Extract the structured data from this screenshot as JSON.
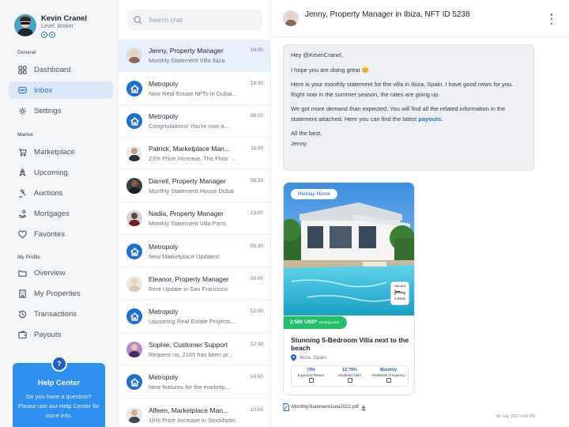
{
  "profile": {
    "name": "Kevin Cranel",
    "level": "Level: Broker"
  },
  "sidebar": {
    "sections": {
      "general": "General",
      "market": "Market",
      "my_profile": "My Profile"
    },
    "items": [
      {
        "label": "Dashboard",
        "icon": "grid-icon"
      },
      {
        "label": "Inbox",
        "icon": "chat-bubble-icon",
        "active": true
      },
      {
        "label": "Settings",
        "icon": "gear-icon"
      },
      {
        "label": "Marketplace",
        "icon": "cart-icon"
      },
      {
        "label": "Upcoming",
        "icon": "rocket-icon"
      },
      {
        "label": "Auctions",
        "icon": "gavel-icon"
      },
      {
        "label": "Mortgages",
        "icon": "hand-coins-icon"
      },
      {
        "label": "Favorites",
        "icon": "heart-icon"
      },
      {
        "label": "Overview",
        "icon": "folder-icon"
      },
      {
        "label": "My Properties",
        "icon": "building-icon"
      },
      {
        "label": "Transactions",
        "icon": "history-icon"
      },
      {
        "label": "Payouts",
        "icon": "wallet-icon"
      }
    ]
  },
  "help": {
    "badge": "?",
    "title": "Help Center",
    "text": "Do you have a question? Please use our Help Center for more info."
  },
  "search": {
    "placeholder": "Search chat",
    "value": ""
  },
  "chats": [
    {
      "name": "Jenny, Property Manager",
      "preview": "Monthly Statement Villa Ibiza",
      "time": "16:00",
      "avatar": "jenny",
      "active": true
    },
    {
      "name": "Metropoly",
      "preview": "New Real-Estate NFTs in Dubai...",
      "time": "18:00",
      "avatar": "metropoly"
    },
    {
      "name": "Metropoly",
      "preview": "Congrtulations! You're now a...",
      "time": "08:00",
      "avatar": "metropoly"
    },
    {
      "name": "Patrick, Marketplace Man...",
      "preview": "23% Price Increase. The Floor ...",
      "time": "11:00",
      "avatar": "patrick"
    },
    {
      "name": "Darrell, Property Manager",
      "preview": "Monthly Statement House Dubai",
      "time": "08:30",
      "avatar": "darrell"
    },
    {
      "name": "Nadia, Property Manager",
      "preview": "Monthly Statement Villa Paris",
      "time": "13:00",
      "avatar": "nadia"
    },
    {
      "name": "Metropoly",
      "preview": "New Marketplace Updates!",
      "time": "09:30",
      "avatar": "metropoly"
    },
    {
      "name": "Eleanor, Property Manager",
      "preview": "Rent Update in San Francisco",
      "time": "09:00",
      "avatar": "eleanor"
    },
    {
      "name": "Metropoly",
      "preview": "Upcoming Real Estate Projects...",
      "time": "12:00",
      "avatar": "metropoly"
    },
    {
      "name": "Sophie, Customer Support",
      "preview": "Request no. 2165 has been pr...",
      "time": "12:30",
      "avatar": "sophie"
    },
    {
      "name": "Metropoly",
      "preview": "New features for the marketp...",
      "time": "14:00",
      "avatar": "metropoly"
    },
    {
      "name": "Alfeen, Marketplace Man...",
      "preview": "16% Price Increase in Stockholm",
      "time": "10:00",
      "avatar": "alfeen"
    }
  ],
  "conversation": {
    "title": "Jenny, Property Manager in Ibiza, NFT ID 5238",
    "message": {
      "greeting": "Hey @KevinCranel,",
      "line1": "I hope you are doing great 😊",
      "line2": "Here is your monthly statement for the villa in Ibiza, Spain. I have good news for you. Right now in the summer season, the rates are going up.",
      "line3_pre": "We got more demand than expected. You will find all the related information in the statement attached. Here you can find the latest ",
      "line3_link": "payouts.",
      "signoff": "All the best,",
      "signature": "Jenny"
    },
    "card": {
      "tag": "Holiday Home",
      "vacant": "Vacant",
      "beds": "5 Beds",
      "price": "2,500 USD*",
      "price_sub": "starting price",
      "title": "Stunning 5-Bedroom Villa next to the beach",
      "location": "Ibiza, Spain",
      "stats": [
        {
          "value": "74%",
          "label": "Expected Return"
        },
        {
          "value": "12.79%",
          "label": "Dividend Yield"
        },
        {
          "value": "Monthly",
          "label": "Dividends Frequency"
        }
      ]
    },
    "attachment": "MonthlyStatementJune2022.pdf",
    "timestamp": "5th July 2022 4:00 PM"
  },
  "colors": {
    "accent": "#2d6fd6",
    "help_card": "#2e8ff0",
    "price_green": "#22c06a",
    "metropoly_blue": "#1f6fcf"
  }
}
